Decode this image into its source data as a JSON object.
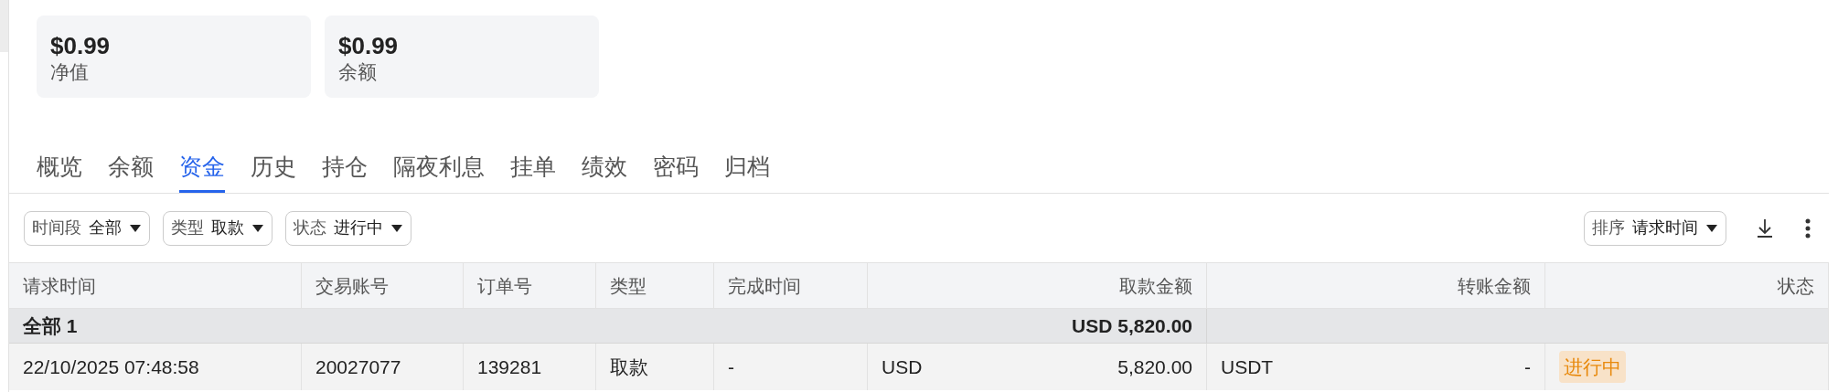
{
  "cards": [
    {
      "value": "$0.99",
      "label": "净值"
    },
    {
      "value": "$0.99",
      "label": "余额"
    }
  ],
  "tabs": [
    {
      "label": "概览",
      "selected": false
    },
    {
      "label": "余额",
      "selected": false
    },
    {
      "label": "资金",
      "selected": true
    },
    {
      "label": "历史",
      "selected": false
    },
    {
      "label": "持仓",
      "selected": false
    },
    {
      "label": "隔夜利息",
      "selected": false
    },
    {
      "label": "挂单",
      "selected": false
    },
    {
      "label": "绩效",
      "selected": false
    },
    {
      "label": "密码",
      "selected": false
    },
    {
      "label": "归档",
      "selected": false
    }
  ],
  "filters": [
    {
      "label": "时间段",
      "value": "全部"
    },
    {
      "label": "类型",
      "value": "取款"
    },
    {
      "label": "状态",
      "value": "进行中"
    }
  ],
  "sort": {
    "label": "排序",
    "value": "请求时间"
  },
  "table": {
    "columns": [
      "请求时间",
      "交易账号",
      "订单号",
      "类型",
      "完成时间",
      "取款金额",
      "转账金额",
      "状态"
    ],
    "group_row": {
      "label": "全部 1",
      "total": "USD 5,820.00"
    },
    "rows": [
      {
        "request_time": "22/10/2025 07:48:58",
        "account": "20027077",
        "order": "139281",
        "type": "取款",
        "completed": "-",
        "withdraw_currency": "USD",
        "withdraw_amount": "5,820.00",
        "transfer_currency": "USDT",
        "transfer_amount": "-",
        "status": "进行中"
      }
    ]
  }
}
